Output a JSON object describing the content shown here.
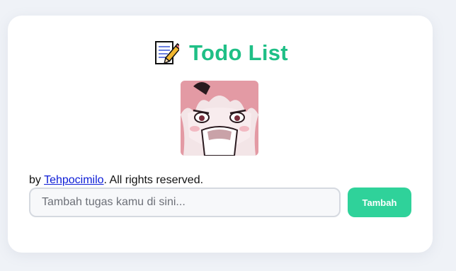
{
  "header": {
    "icon": "memo-icon",
    "title": "Todo List"
  },
  "avatar": {
    "icon": "anime-girl-avatar"
  },
  "credit": {
    "prefix": "by ",
    "author": "Tehpocimilo",
    "suffix": ". All rights reserved."
  },
  "todo_form": {
    "input_placeholder": "Tambah tugas kamu di sini...",
    "input_value": "",
    "add_label": "Tambah"
  },
  "colors": {
    "accent": "#1fbf86",
    "button": "#2fd29a",
    "background": "#eff2f7"
  }
}
